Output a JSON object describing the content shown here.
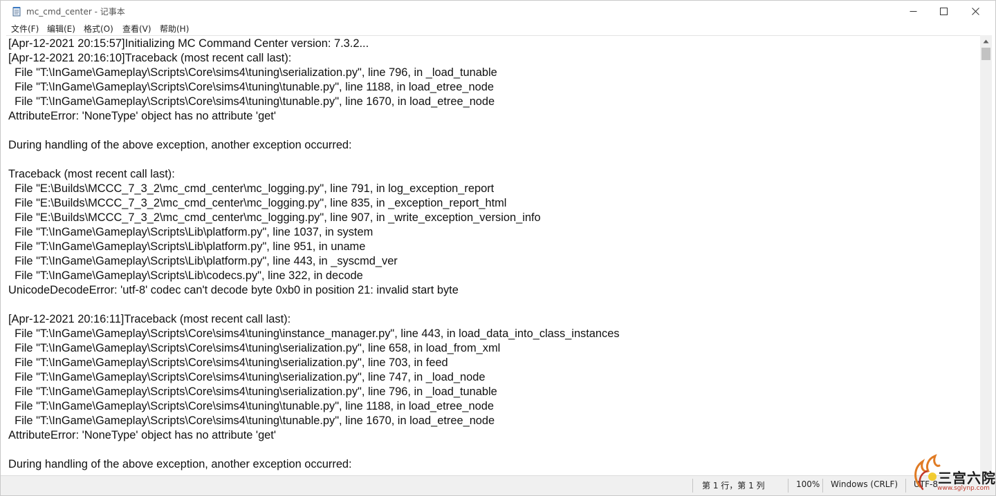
{
  "window": {
    "title": "mc_cmd_center - 记事本",
    "icon": "notepad-icon"
  },
  "menu": {
    "items": [
      {
        "label": "文件(F)"
      },
      {
        "label": "编辑(E)"
      },
      {
        "label": "格式(O)"
      },
      {
        "label": "查看(V)"
      },
      {
        "label": "帮助(H)"
      }
    ]
  },
  "editor": {
    "lines": [
      "[Apr-12-2021 20:15:57]Initializing MC Command Center version: 7.3.2...",
      "[Apr-12-2021 20:16:10]Traceback (most recent call last):",
      "  File \"T:\\InGame\\Gameplay\\Scripts\\Core\\sims4\\tuning\\serialization.py\", line 796, in _load_tunable",
      "  File \"T:\\InGame\\Gameplay\\Scripts\\Core\\sims4\\tuning\\tunable.py\", line 1188, in load_etree_node",
      "  File \"T:\\InGame\\Gameplay\\Scripts\\Core\\sims4\\tuning\\tunable.py\", line 1670, in load_etree_node",
      "AttributeError: 'NoneType' object has no attribute 'get'",
      "",
      "During handling of the above exception, another exception occurred:",
      "",
      "Traceback (most recent call last):",
      "  File \"E:\\Builds\\MCCC_7_3_2\\mc_cmd_center\\mc_logging.py\", line 791, in log_exception_report",
      "  File \"E:\\Builds\\MCCC_7_3_2\\mc_cmd_center\\mc_logging.py\", line 835, in _exception_report_html",
      "  File \"E:\\Builds\\MCCC_7_3_2\\mc_cmd_center\\mc_logging.py\", line 907, in _write_exception_version_info",
      "  File \"T:\\InGame\\Gameplay\\Scripts\\Lib\\platform.py\", line 1037, in system",
      "  File \"T:\\InGame\\Gameplay\\Scripts\\Lib\\platform.py\", line 951, in uname",
      "  File \"T:\\InGame\\Gameplay\\Scripts\\Lib\\platform.py\", line 443, in _syscmd_ver",
      "  File \"T:\\InGame\\Gameplay\\Scripts\\Lib\\codecs.py\", line 322, in decode",
      "UnicodeDecodeError: 'utf-8' codec can't decode byte 0xb0 in position 21: invalid start byte",
      "",
      "[Apr-12-2021 20:16:11]Traceback (most recent call last):",
      "  File \"T:\\InGame\\Gameplay\\Scripts\\Core\\sims4\\tuning\\instance_manager.py\", line 443, in load_data_into_class_instances",
      "  File \"T:\\InGame\\Gameplay\\Scripts\\Core\\sims4\\tuning\\serialization.py\", line 658, in load_from_xml",
      "  File \"T:\\InGame\\Gameplay\\Scripts\\Core\\sims4\\tuning\\serialization.py\", line 703, in feed",
      "  File \"T:\\InGame\\Gameplay\\Scripts\\Core\\sims4\\tuning\\serialization.py\", line 747, in _load_node",
      "  File \"T:\\InGame\\Gameplay\\Scripts\\Core\\sims4\\tuning\\serialization.py\", line 796, in _load_tunable",
      "  File \"T:\\InGame\\Gameplay\\Scripts\\Core\\sims4\\tuning\\tunable.py\", line 1188, in load_etree_node",
      "  File \"T:\\InGame\\Gameplay\\Scripts\\Core\\sims4\\tuning\\tunable.py\", line 1670, in load_etree_node",
      "AttributeError: 'NoneType' object has no attribute 'get'",
      "",
      "During handling of the above exception, another exception occurred:"
    ]
  },
  "status": {
    "position": "第 1 行，第 1 列",
    "zoom": "100%",
    "line_ending": "Windows (CRLF)",
    "encoding": "UTF-8"
  },
  "watermark": {
    "text": "三宫六院",
    "url": "www.sglynp.com"
  }
}
